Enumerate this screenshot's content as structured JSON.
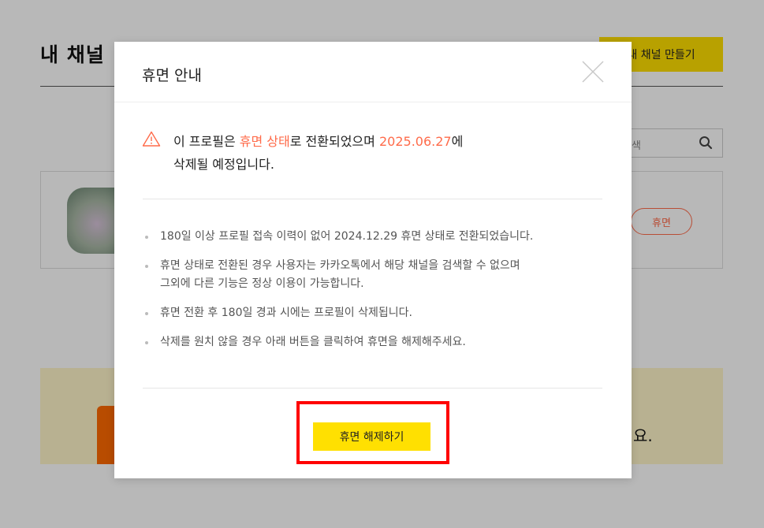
{
  "background": {
    "title": "내 채널",
    "create_button": "새 채널 만들기",
    "search_placeholder": "아이디 검색",
    "dormant_badge": "휴면",
    "banner_text": "요."
  },
  "modal": {
    "title": "휴면 안내",
    "notice": {
      "prefix": "이 프로필은 ",
      "status": "휴면 상태",
      "middle": "로 전환되었으며 ",
      "date": "2025.06.27",
      "suffix": "에",
      "line2": "삭제될 예정입니다."
    },
    "bullets": [
      "180일 이상 프로필 접속 이력이 없어 2024.12.29 휴면 상태로 전환되었습니다.",
      "휴면 상태로 전환된 경우 사용자는 카카오톡에서 해당 채널을 검색할 수 없으며",
      "그외에 다른 기능은 정상 이용이 가능합니다.",
      "휴면 전환 후 180일 경과 시에는 프로필이 삭제됩니다.",
      "삭제를 원치 않을 경우 아래 버튼을 클릭하여 휴면을 해제해주세요."
    ],
    "release_button": "휴면 해제하기"
  },
  "colors": {
    "accent_yellow": "#ffe001",
    "highlight": "#ff6b4a",
    "annotation_box": "#ff0000"
  }
}
